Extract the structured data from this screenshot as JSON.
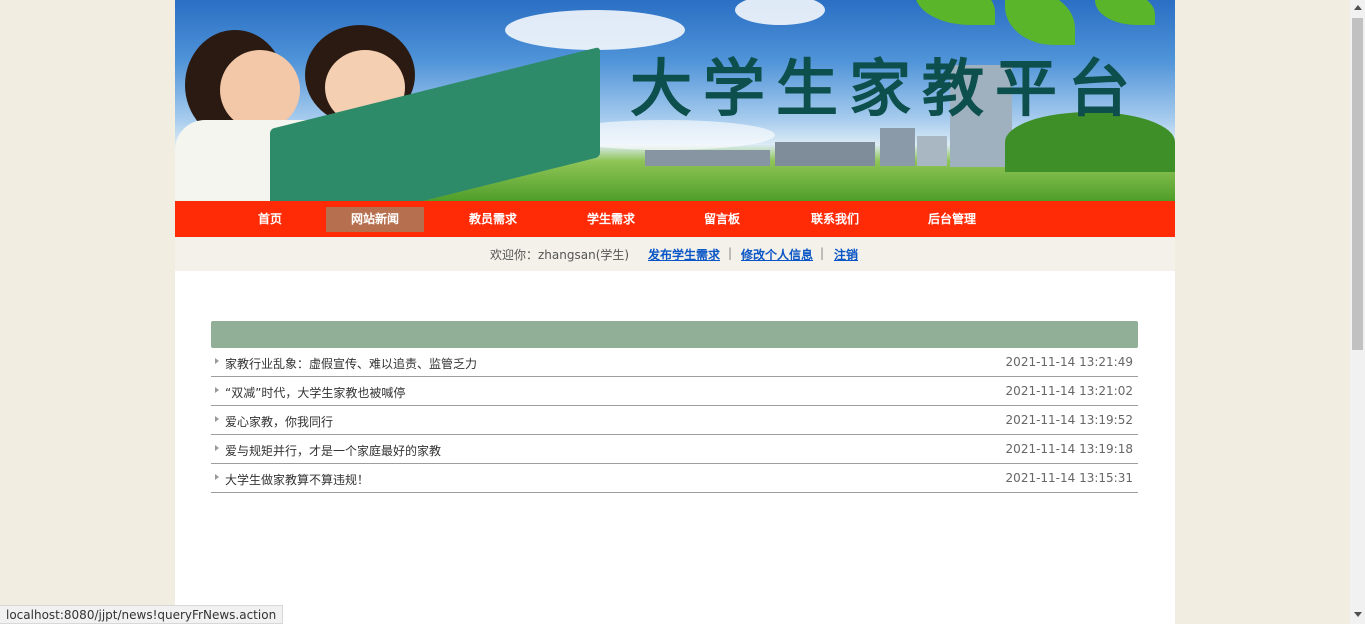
{
  "banner": {
    "title": "大学生家教平台"
  },
  "nav": {
    "items": [
      {
        "label": "首页"
      },
      {
        "label": "网站新闻",
        "active": true
      },
      {
        "label": "教员需求"
      },
      {
        "label": "学生需求"
      },
      {
        "label": "留言板"
      },
      {
        "label": "联系我们"
      },
      {
        "label": "后台管理"
      }
    ]
  },
  "userbar": {
    "welcome": "欢迎你：zhangsan(学生)",
    "links": [
      "发布学生需求",
      "修改个人信息",
      "注销"
    ],
    "separator": "|"
  },
  "news": {
    "items": [
      {
        "title": "家教行业乱象：虚假宣传、难以追责、监管乏力",
        "date": "2021-11-14 13:21:49"
      },
      {
        "title": "“双减”时代，大学生家教也被喊停",
        "date": "2021-11-14 13:21:02"
      },
      {
        "title": "爱心家教，你我同行",
        "date": "2021-11-14 13:19:52"
      },
      {
        "title": "爱与规矩并行，才是一个家庭最好的家教",
        "date": "2021-11-14 13:19:18"
      },
      {
        "title": "大学生做家教算不算违规！",
        "date": "2021-11-14 13:15:31"
      }
    ]
  },
  "status_url": "localhost:8080/jjpt/news!queryFrNews.action",
  "colors": {
    "nav_bg": "#ff2a06",
    "nav_active": "#b6704f",
    "title_color": "#0d4f4c",
    "link_color": "#0b56c6",
    "news_header": "#91ae96"
  }
}
